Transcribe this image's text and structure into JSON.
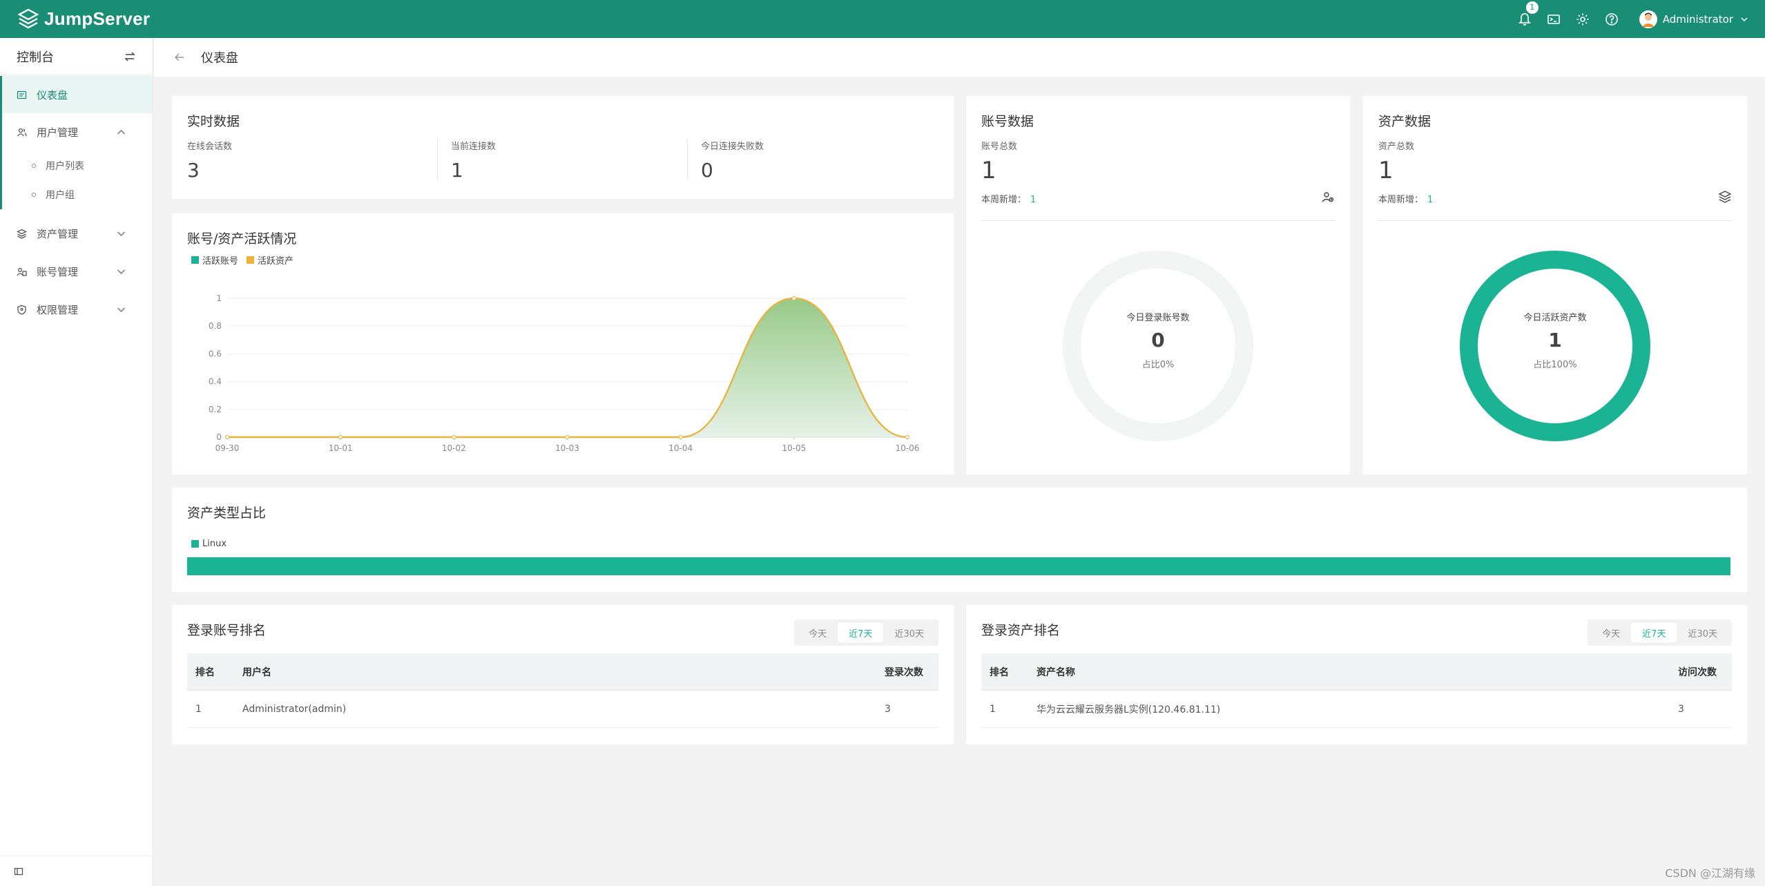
{
  "header": {
    "app_name": "JumpServer",
    "notification_count": "1",
    "user_name": "Administrator"
  },
  "sidebar": {
    "title": "控制台",
    "items": [
      {
        "label": "仪表盘",
        "icon": "dashboard-icon",
        "active": true
      },
      {
        "label": "用户管理",
        "icon": "users-icon",
        "expanded": true
      },
      {
        "label": "用户列表",
        "sub": true
      },
      {
        "label": "用户组",
        "sub": true
      },
      {
        "label": "资产管理",
        "icon": "assets-icon"
      },
      {
        "label": "账号管理",
        "icon": "accounts-icon"
      },
      {
        "label": "权限管理",
        "icon": "permission-icon"
      }
    ]
  },
  "page": {
    "title": "仪表盘"
  },
  "realtime": {
    "title": "实时数据",
    "stats": [
      {
        "label": "在线会话数",
        "value": "3"
      },
      {
        "label": "当前连接数",
        "value": "1"
      },
      {
        "label": "今日连接失败数",
        "value": "0"
      }
    ]
  },
  "activity_chart": {
    "title": "账号/资产活跃情况",
    "legend": [
      "活跃账号",
      "活跃资产"
    ]
  },
  "chart_data": {
    "type": "area",
    "title": "账号/资产活跃情况",
    "categories": [
      "09-30",
      "10-01",
      "10-02",
      "10-03",
      "10-04",
      "10-05",
      "10-06"
    ],
    "ylim": [
      0,
      1
    ],
    "yticks": [
      "1",
      "0.8",
      "0.6",
      "0.4",
      "0.2",
      "0"
    ],
    "series": [
      {
        "name": "活跃账号",
        "color": "#1ab394",
        "values": [
          0,
          0,
          0,
          0,
          0,
          1,
          0
        ]
      },
      {
        "name": "活跃资产",
        "color": "#f0b234",
        "values": [
          0,
          0,
          0,
          0,
          0,
          1,
          0
        ]
      }
    ],
    "legend": "top-left",
    "grid": true
  },
  "account_data": {
    "title": "账号数据",
    "total_label": "账号总数",
    "total": "1",
    "weekly_label": "本周新增：",
    "weekly_value": "1",
    "donut_label": "今日登录账号数",
    "donut_value": "0",
    "donut_pct": "占比0%",
    "donut_fraction": 0
  },
  "asset_data": {
    "title": "资产数据",
    "total_label": "资产总数",
    "total": "1",
    "weekly_label": "本周新增：",
    "weekly_value": "1",
    "donut_label": "今日活跃资产数",
    "donut_value": "1",
    "donut_pct": "占比100%",
    "donut_fraction": 1
  },
  "asset_types": {
    "title": "资产类型占比",
    "legend": "Linux",
    "share": 1
  },
  "login_account_rank": {
    "title": "登录账号排名",
    "tabs": [
      "今天",
      "近7天",
      "近30天"
    ],
    "active_tab": 1,
    "columns": [
      "排名",
      "用户名",
      "登录次数"
    ],
    "rows": [
      [
        "1",
        "Administrator(admin)",
        "3"
      ]
    ]
  },
  "login_asset_rank": {
    "title": "登录资产排名",
    "tabs": [
      "今天",
      "近7天",
      "近30天"
    ],
    "active_tab": 1,
    "columns": [
      "排名",
      "资产名称",
      "访问次数"
    ],
    "rows": [
      [
        "1",
        "华为云云耀云服务器L实例(120.46.81.11)",
        "3"
      ]
    ]
  },
  "watermark": "CSDN @江湖有缘",
  "colors": {
    "brand": "#1a8e75",
    "accent": "#1ab394",
    "asset_series": "#f0b234"
  }
}
